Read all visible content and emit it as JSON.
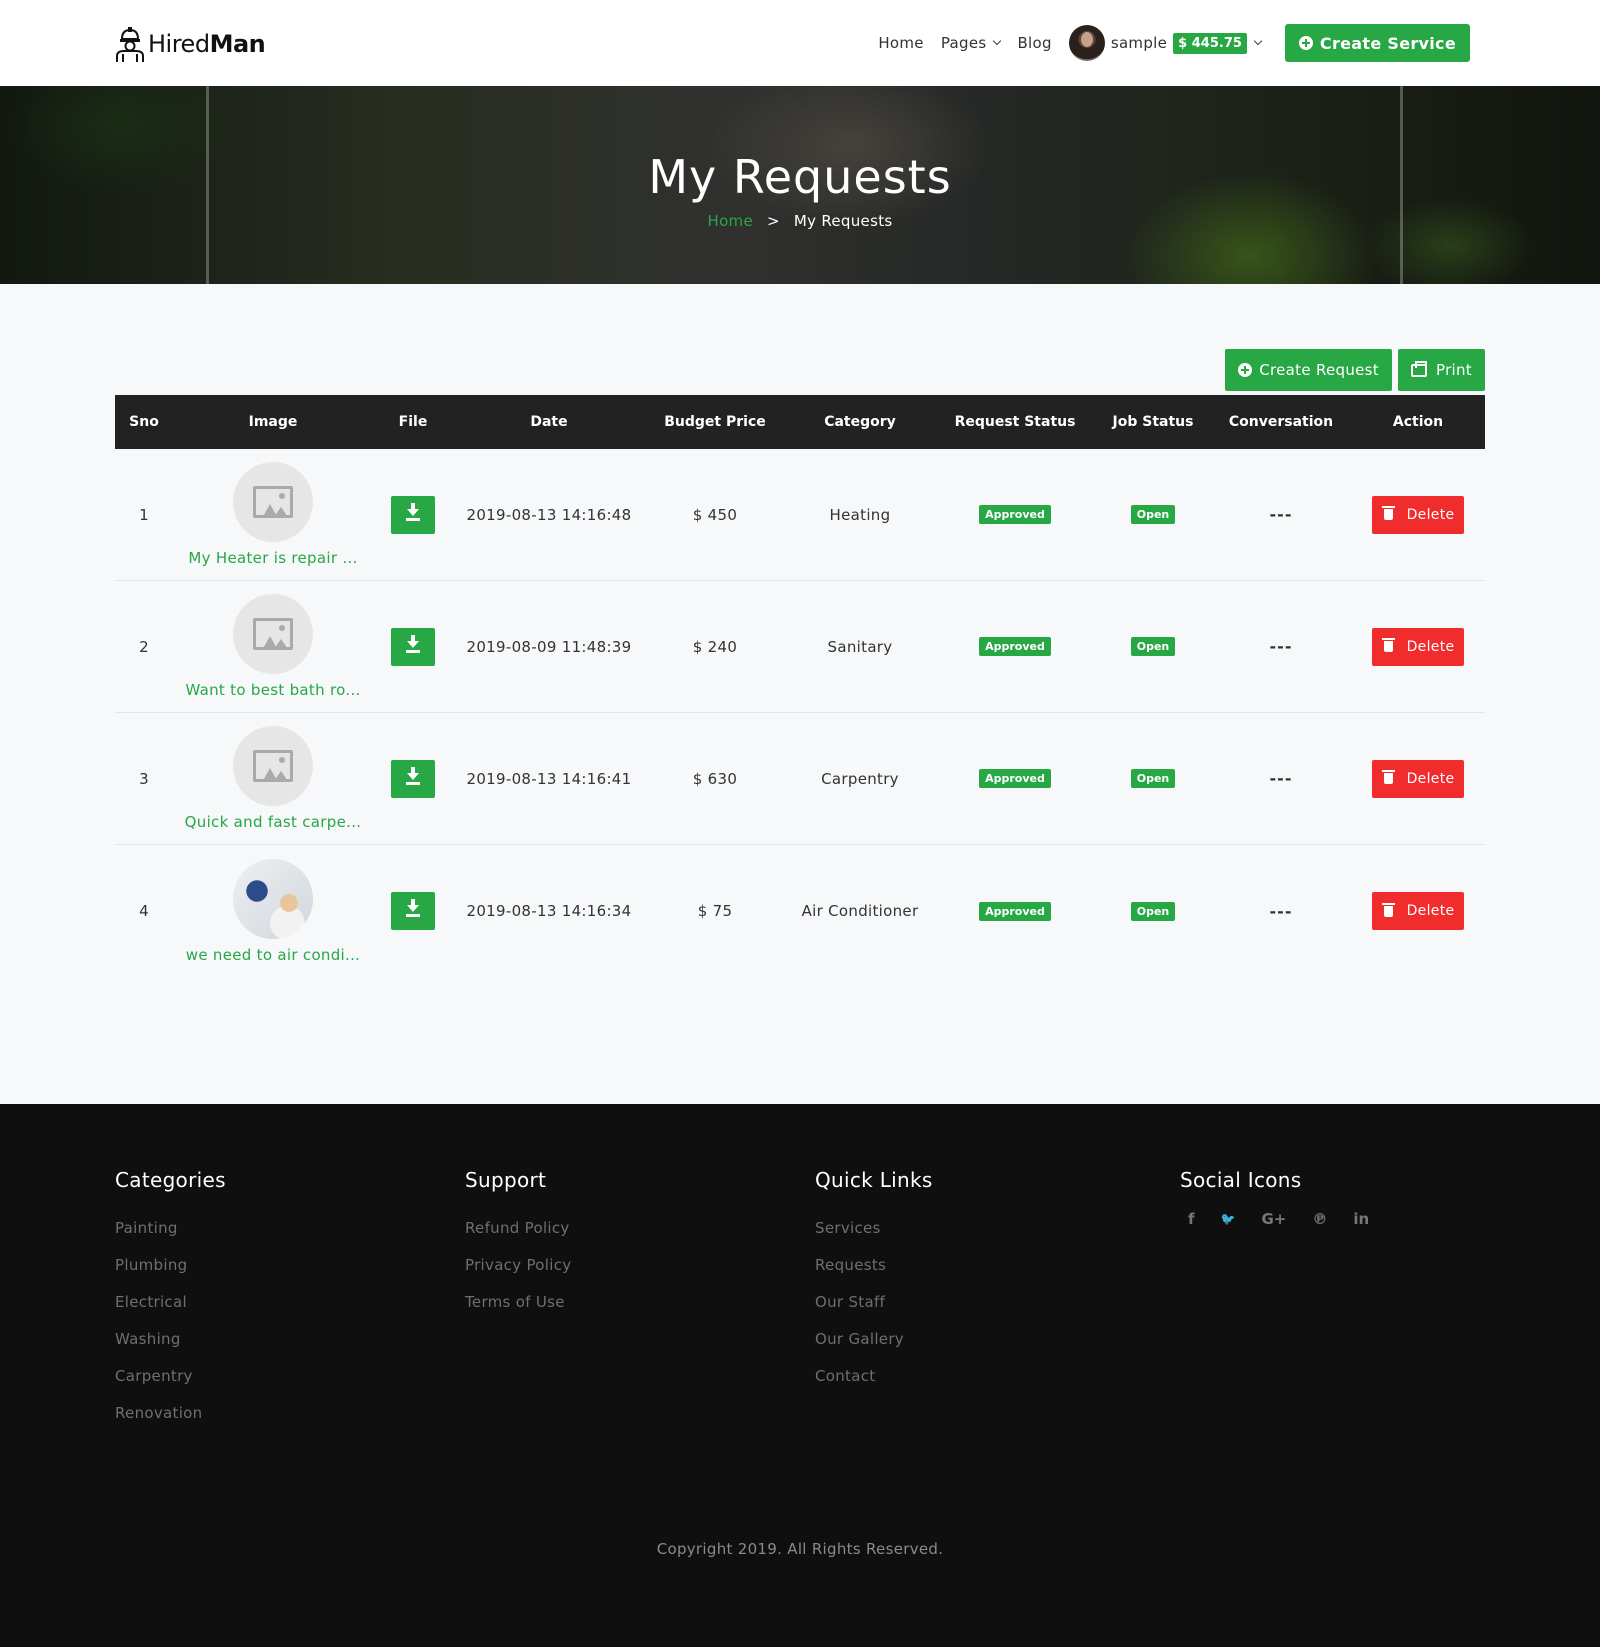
{
  "header": {
    "logo_light": "Hired",
    "logo_bold": "Man",
    "nav": {
      "home": "Home",
      "pages": "Pages",
      "blog": "Blog"
    },
    "user": {
      "name": "sample",
      "balance": "$ 445.75"
    },
    "create_service": "Create Service"
  },
  "hero": {
    "title": "My Requests",
    "breadcrumb": {
      "home": "Home",
      "separator": ">",
      "current": "My Requests"
    }
  },
  "actions": {
    "create_request": "Create Request",
    "print": "Print"
  },
  "table": {
    "columns": [
      "Sno",
      "Image",
      "File",
      "Date",
      "Budget Price",
      "Category",
      "Request Status",
      "Job Status",
      "Conversation",
      "Action"
    ],
    "rows": [
      {
        "sno": "1",
        "caption": "My Heater is repair ...",
        "date": "2019-08-13 14:16:48",
        "budget": "$ 450",
        "category": "Heating",
        "request_status": "Approved",
        "job_status": "Open",
        "conversation": "---",
        "action": "Delete",
        "image": "placeholder-icon"
      },
      {
        "sno": "2",
        "caption": "Want to best bath ro...",
        "date": "2019-08-09 11:48:39",
        "budget": "$ 240",
        "category": "Sanitary",
        "request_status": "Approved",
        "job_status": "Open",
        "conversation": "---",
        "action": "Delete",
        "image": "placeholder-icon"
      },
      {
        "sno": "3",
        "caption": "Quick and fast carpe...",
        "date": "2019-08-13 14:16:41",
        "budget": "$ 630",
        "category": "Carpentry",
        "request_status": "Approved",
        "job_status": "Open",
        "conversation": "---",
        "action": "Delete",
        "image": "placeholder-icon"
      },
      {
        "sno": "4",
        "caption": "we need to air condi...",
        "date": "2019-08-13 14:16:34",
        "budget": "$ 75",
        "category": "Air Conditioner",
        "request_status": "Approved",
        "job_status": "Open",
        "conversation": "---",
        "action": "Delete",
        "image": "photo"
      }
    ]
  },
  "footer": {
    "categories": {
      "title": "Categories",
      "links": [
        "Painting",
        "Plumbing",
        "Electrical",
        "Washing",
        "Carpentry",
        "Renovation"
      ]
    },
    "support": {
      "title": "Support",
      "links": [
        "Refund Policy",
        "Privacy Policy",
        "Terms of Use"
      ]
    },
    "quick_links": {
      "title": "Quick Links",
      "links": [
        "Services",
        "Requests",
        "Our Staff",
        "Our Gallery",
        "Contact"
      ]
    },
    "social": {
      "title": "Social Icons",
      "icons": [
        {
          "name": "facebook-icon",
          "glyph": "f"
        },
        {
          "name": "twitter-icon",
          "glyph": "🐦"
        },
        {
          "name": "google-plus-icon",
          "glyph": "G+"
        },
        {
          "name": "pinterest-icon",
          "glyph": "℗"
        },
        {
          "name": "linkedin-icon",
          "glyph": "in"
        }
      ]
    },
    "copyright": "Copyright 2019. All Rights Reserved."
  },
  "colors": {
    "accent": "#28a745",
    "danger": "#f12c2c",
    "table_header": "#222222",
    "footer_bg": "#0f0f0f"
  }
}
